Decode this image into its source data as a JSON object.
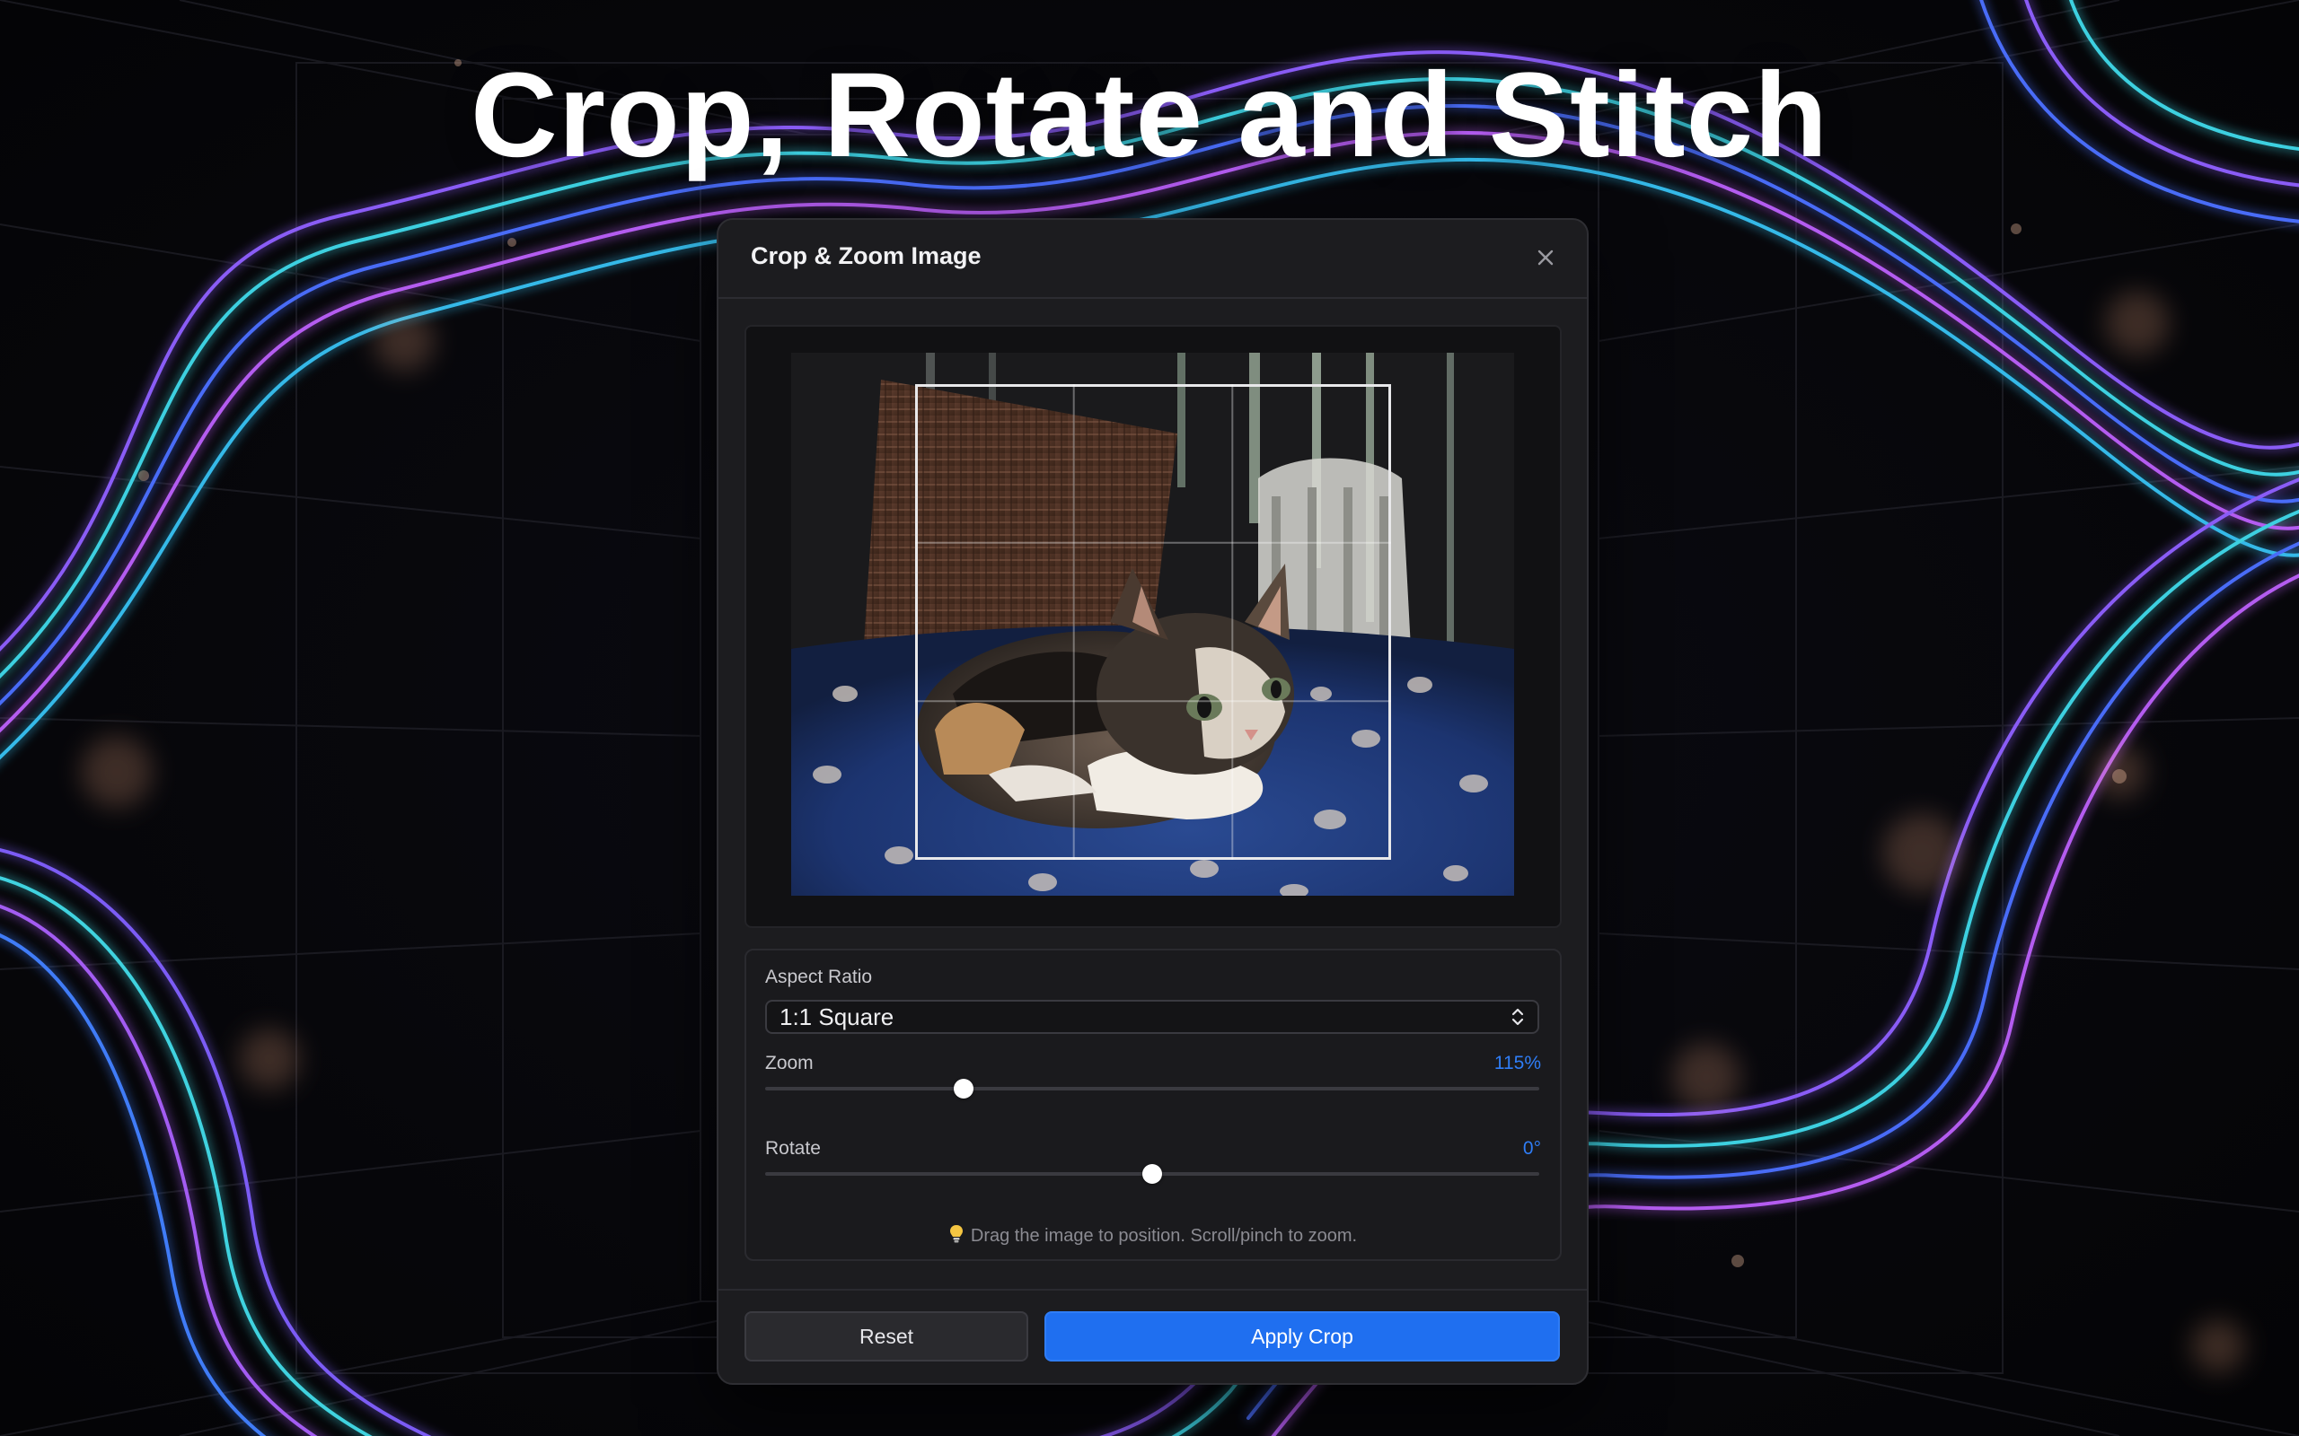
{
  "headline": "Crop, Rotate and Stitch",
  "modal": {
    "title": "Crop & Zoom Image",
    "close_icon": "close-icon"
  },
  "preview": {
    "image": "kitten-photo",
    "crop_overlay": "rule-of-thirds-grid"
  },
  "controls": {
    "aspect_ratio": {
      "label": "Aspect Ratio",
      "selected": "1:1 Square",
      "icon": "chevron-updown-icon"
    },
    "zoom": {
      "label": "Zoom",
      "value_text": "115%",
      "value": 115,
      "fraction": 0.256
    },
    "rotate": {
      "label": "Rotate",
      "value_text": "0°",
      "value": 0,
      "fraction": 0.5
    },
    "hint": {
      "icon": "lightbulb-icon",
      "text": "Drag the image to position. Scroll/pinch to zoom."
    }
  },
  "buttons": {
    "reset": "Reset",
    "apply": "Apply Crop"
  },
  "colors": {
    "accent": "#2f7df6",
    "primary_button": "#1f6ff0",
    "modal_bg": "#1c1c1f",
    "page_bg": "#07070b"
  }
}
